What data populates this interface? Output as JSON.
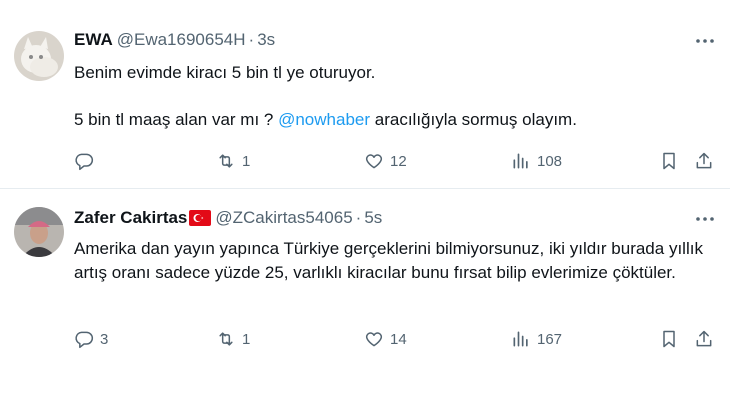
{
  "tweets": [
    {
      "author_name": "EWA",
      "handle": "@Ewa1690654H",
      "dot": "·",
      "time": "3s",
      "text_line1": "Benim evimde kiracı 5 bin tl ye oturuyor.",
      "text_line2_before": "5 bin tl maaş alan var mı ? ",
      "mention": "@nowhaber",
      "text_line2_after": " aracılığıyla sormuş olayım.",
      "reply_count": "",
      "retweet_count": "1",
      "like_count": "12",
      "view_count": "108"
    },
    {
      "author_name": "Zafer Cakirtas",
      "handle": "@ZCakirtas54065",
      "dot": "·",
      "time": "5s",
      "text": "Amerika dan yayın yapınca Türkiye gerçeklerini bilmiyorsunuz, iki yıldır burada yıllık artış oranı sadece yüzde 25, varlıklı kiracılar bunu fırsat bilip evlerimize çöktüler.",
      "reply_count": "3",
      "retweet_count": "1",
      "like_count": "14",
      "view_count": "167"
    }
  ],
  "icons": {
    "reply": "reply-icon",
    "retweet": "retweet-icon",
    "like": "heart-icon",
    "views": "views-icon",
    "bookmark": "bookmark-icon",
    "share": "share-icon",
    "more": "more-icon",
    "flag": "turkey-flag-icon"
  },
  "colors": {
    "mention": "#1d9bf0",
    "muted": "#536471",
    "text": "#0f1419",
    "divider": "#e6ecf0"
  }
}
